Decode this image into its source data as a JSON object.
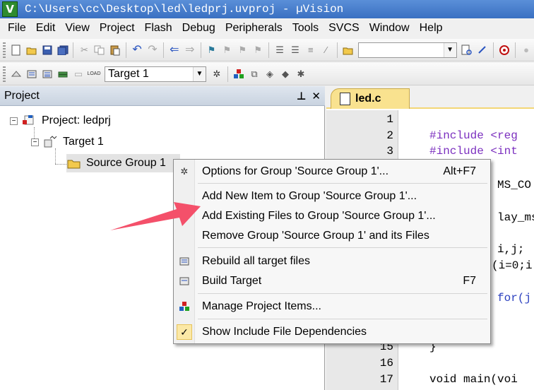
{
  "window": {
    "title": "C:\\Users\\cc\\Desktop\\led\\ledprj.uvproj - µVision",
    "icon_glyph": "V"
  },
  "menu": [
    "File",
    "Edit",
    "View",
    "Project",
    "Flash",
    "Debug",
    "Peripherals",
    "Tools",
    "SVCS",
    "Window",
    "Help"
  ],
  "toolbar": {
    "target_select": "Target 1",
    "find_value": ""
  },
  "project_panel": {
    "title": "Project",
    "pin_glyph": "⊥",
    "close_glyph": "✕",
    "tree": {
      "project": "Project: ledprj",
      "target": "Target 1",
      "group": "Source Group 1"
    }
  },
  "editor": {
    "active_tab": "led.c",
    "lines": [
      {
        "num": "1",
        "code": ""
      },
      {
        "num": "2",
        "code": "#include <reg"
      },
      {
        "num": "3",
        "code": "#include <int"
      },
      {
        "num": "15",
        "code": "}"
      },
      {
        "num": "16",
        "code": ""
      },
      {
        "num": "17",
        "code": "void main(voi"
      }
    ],
    "partial_code": [
      "MS_CO",
      "lay_ms",
      "i,j;",
      "(i=0;i",
      "for(j"
    ]
  },
  "context_menu": {
    "items": [
      {
        "label": "Options for Group 'Source Group 1'...",
        "shortcut": "Alt+F7",
        "icon": "options-wand-icon"
      },
      {
        "label": "Add New  Item to Group 'Source Group 1'...",
        "shortcut": "",
        "icon": ""
      },
      {
        "label": "Add Existing Files to Group 'Source Group 1'...",
        "shortcut": "",
        "icon": ""
      },
      {
        "label": "Remove Group 'Source Group 1' and its Files",
        "shortcut": "",
        "icon": ""
      },
      {
        "label": "Rebuild all target files",
        "shortcut": "",
        "icon": "rebuild-icon"
      },
      {
        "label": "Build Target",
        "shortcut": "F7",
        "icon": "build-icon"
      },
      {
        "label": "Manage Project Items...",
        "shortcut": "",
        "icon": "manage-items-icon"
      },
      {
        "label": "Show Include File Dependencies",
        "shortcut": "",
        "icon": "check-icon",
        "checked": true
      }
    ]
  },
  "colors": {
    "annotation_arrow": "#f4506a",
    "tab_active": "#f9e28f",
    "keyword": "#7b2fbf"
  }
}
